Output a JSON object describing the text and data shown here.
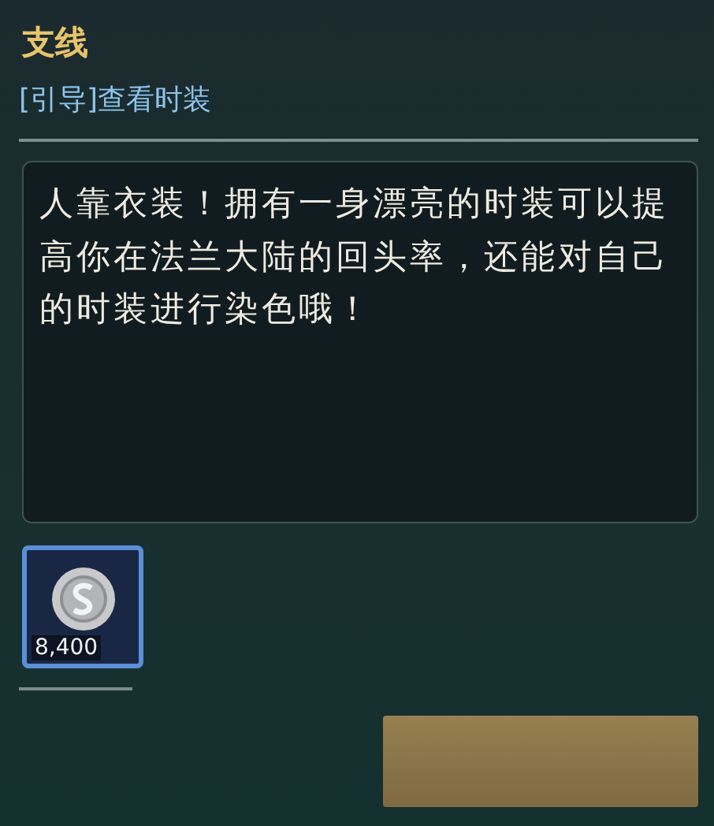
{
  "header": {
    "category": "支线",
    "quest": "[引导]查看时装"
  },
  "description": "人靠衣装！拥有一身漂亮的时装可以提高你在法兰大陆的回头率，还能对自己的时装进行染色哦！",
  "rewards": [
    {
      "kind": "silver",
      "count": "8,400"
    }
  ]
}
